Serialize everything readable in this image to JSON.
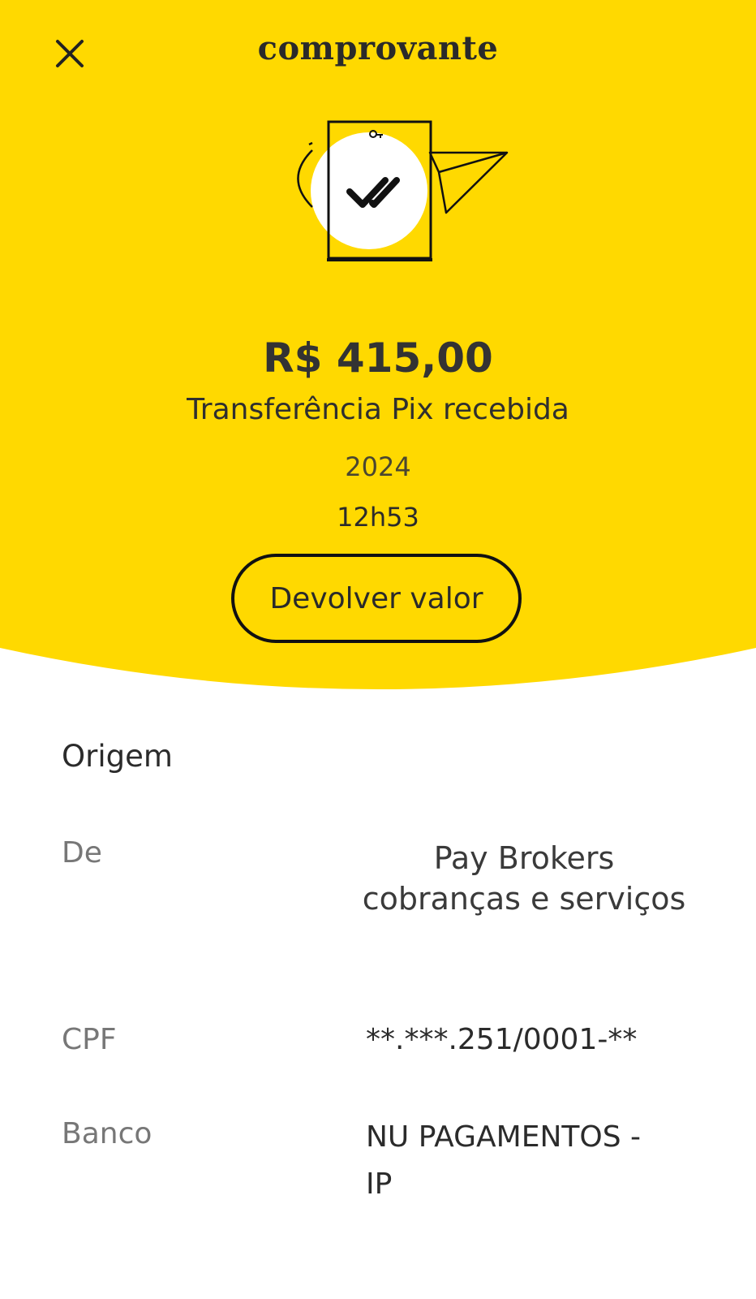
{
  "header": {
    "title": "comprovante",
    "close_icon": "close-icon",
    "background_color": "#FFD900"
  },
  "illustration": {
    "icon": "receipt-check-paper-plane-icon"
  },
  "transfer": {
    "amount": "R$ 415,00",
    "description": "Transferência Pix recebida",
    "date": "2024",
    "time": "12h53",
    "return_button_label": "Devolver valor"
  },
  "origin": {
    "section_title": "Origem",
    "from_label": "De",
    "from_value_line1": "Pay Brokers",
    "from_value_line2": "cobranças e serviços",
    "document_label": "CPF",
    "document_value": "**.***.251/0001-**",
    "bank_label": "Banco",
    "bank_value_line1": "NU PAGAMENTOS -",
    "bank_value_line2": "IP"
  }
}
